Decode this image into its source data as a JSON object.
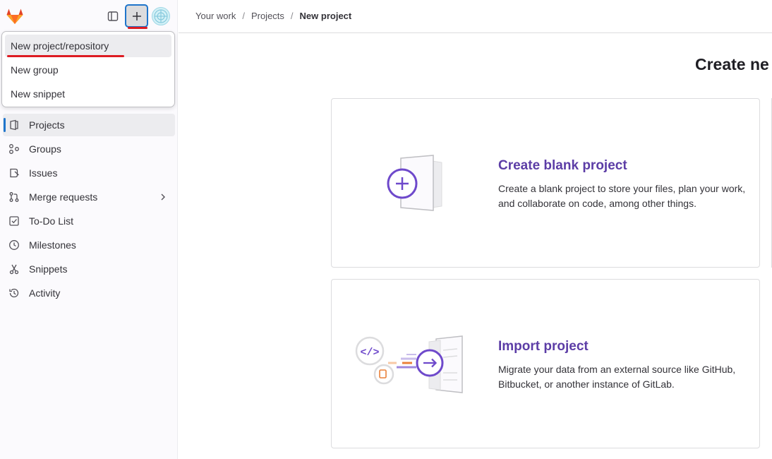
{
  "sidebar": {
    "logo_icon": "gitlab-tanuki-icon",
    "toggle_icon": "sidebar-toggle-icon",
    "create_icon": "plus-icon",
    "avatar_icon": "user-avatar",
    "dropdown": [
      {
        "label": "New project/repository"
      },
      {
        "label": "New group"
      },
      {
        "label": "New snippet"
      }
    ],
    "nav": [
      {
        "label": "Projects",
        "icon": "project-icon"
      },
      {
        "label": "Groups",
        "icon": "group-icon"
      },
      {
        "label": "Issues",
        "icon": "issues-icon"
      },
      {
        "label": "Merge requests",
        "icon": "merge-request-icon"
      },
      {
        "label": "To-Do List",
        "icon": "todo-icon"
      },
      {
        "label": "Milestones",
        "icon": "milestone-icon"
      },
      {
        "label": "Snippets",
        "icon": "snippet-icon"
      },
      {
        "label": "Activity",
        "icon": "history-icon"
      }
    ]
  },
  "breadcrumb": {
    "items": [
      "Your work",
      "Projects"
    ],
    "current": "New project",
    "separator": "/"
  },
  "main": {
    "title": "Create ne",
    "cards": [
      {
        "title": "Create blank project",
        "desc": "Create a blank project to store your files, plan your work, and collaborate on code, among other things."
      },
      {
        "title": "Import project",
        "desc": "Migrate your data from an external source like GitHub, Bitbucket, or another instance of GitLab."
      }
    ]
  },
  "colors": {
    "accent": "#1f75cb",
    "link_purple": "#5c3da6",
    "highlight_red": "#dd1b22"
  }
}
